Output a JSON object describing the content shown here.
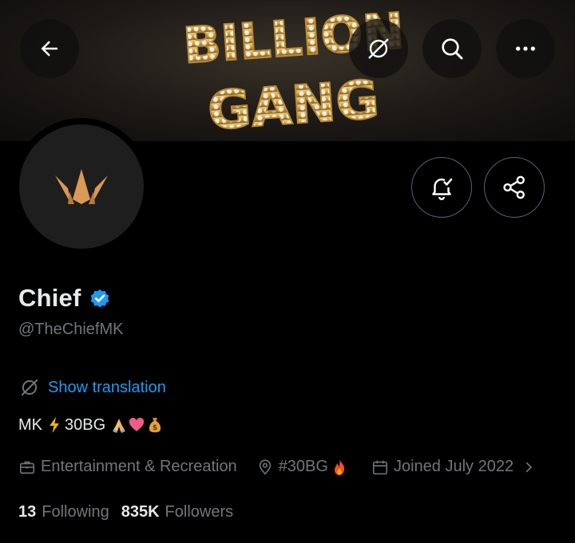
{
  "banner": {
    "art_text": [
      "BILLION",
      "GANG"
    ]
  },
  "top_bar": {
    "back_icon": "arrow-left-icon",
    "translate_icon": "translate-slash-icon",
    "search_icon": "search-icon",
    "more_icon": "more-horizontal-icon"
  },
  "profile": {
    "name": "Chief",
    "handle": "@TheChiefMK",
    "translate_link": "Show translation",
    "bio_text": "MK",
    "bio_tail": "30BG",
    "category": "Entertainment & Recreation",
    "location": "#30BG",
    "joined": "Joined July 2022",
    "following_count": "13",
    "following_label": "Following",
    "followers_count": "835K",
    "followers_label": "Followers"
  },
  "actions": {
    "notify_icon": "bell-check-icon",
    "share_icon": "share-icon"
  },
  "colors": {
    "background": "#000000",
    "accent": "#1d9bf0",
    "secondary_text": "#71767b",
    "avatar_gold": "#d99a55"
  }
}
